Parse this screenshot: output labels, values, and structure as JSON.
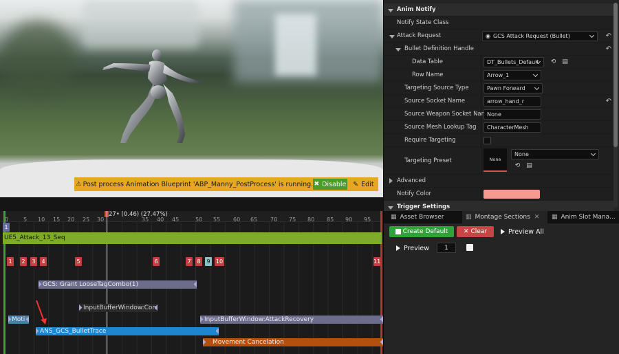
{
  "viewport": {
    "notification": {
      "message": "Post process Animation Blueprint 'ABP_Manny_PostProcess' is running.",
      "disable_label": "Disable",
      "edit_label": "Edit",
      "color": "#e6a821"
    }
  },
  "timeline": {
    "ruler_ticks": [
      "0",
      "5",
      "10",
      "15",
      "20",
      "25",
      "30",
      "35",
      "40",
      "45",
      "50",
      "55",
      "60",
      "65",
      "70",
      "75",
      "80",
      "85",
      "90",
      "95"
    ],
    "playhead_label": "27• (0.46) (27.47%)",
    "section_index": "1",
    "segment_name": "UE5_Attack_13_Seq",
    "notify_markers": [
      "1",
      "2",
      "3",
      "4",
      "5",
      "6",
      "7",
      "8",
      "9",
      "10",
      "11"
    ],
    "selected_marker": "9",
    "notify_states": [
      {
        "label": "GCS: Grant LooseTagCombo(1)"
      },
      {
        "label": "InputBufferWindow:Combo"
      },
      {
        "label": "Moti"
      },
      {
        "label": "InputBufferWindow:AttackRecovery"
      },
      {
        "label": "ANS_GCS_BulletTrace"
      },
      {
        "label": "Movement Cancelation"
      }
    ]
  },
  "details": {
    "section_title": "Anim Notify",
    "rows": {
      "notify_state_class": "Notify State Class",
      "attack_request": "Attack Request",
      "attack_request_value": "GCS Attack Request (Bullet)",
      "bullet_def": "Bullet Definition Handle",
      "data_table": "Data Table",
      "data_table_value": "DT_Bullets_Default",
      "row_name": "Row Name",
      "row_name_value": "Arrow_1",
      "targeting_source_type": "Targeting Source Type",
      "targeting_source_type_value": "Pawn Forward",
      "source_socket_name": "Source Socket Name",
      "source_socket_name_value": "arrow_hand_r",
      "source_weapon_socket_name": "Source Weapon Socket Name",
      "source_weapon_socket_name_value": "None",
      "source_mesh_lookup_tag": "Source Mesh Lookup Tag",
      "source_mesh_lookup_tag_value": "CharacterMesh",
      "require_targeting": "Require Targeting",
      "targeting_preset": "Targeting Preset",
      "targeting_preset_thumb": "None",
      "targeting_preset_value": "None",
      "advanced": "Advanced",
      "notify_color": "Notify Color",
      "notify_color_value": "#f59a8e",
      "trigger_settings": "Trigger Settings"
    }
  },
  "bottom_panel": {
    "tabs": [
      "Asset Browser",
      "Montage Sections",
      "Anim Slot Mana..."
    ],
    "active_tab": "Montage Sections",
    "create_default_label": "Create Default",
    "clear_label": "Clear",
    "preview_all_label": "Preview All",
    "preview_label": "Preview",
    "section_number": "1"
  }
}
